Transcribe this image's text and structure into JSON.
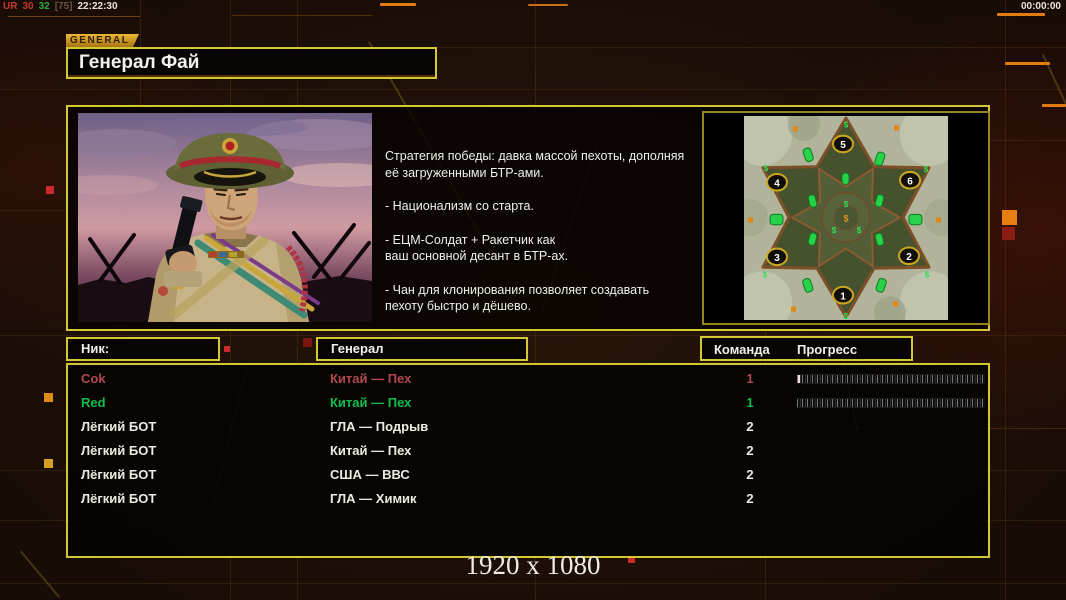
{
  "hud": {
    "stats_parts": [
      {
        "text": "UR",
        "color": "#c23b2b"
      },
      {
        "text": "30",
        "color": "#c23b2b"
      },
      {
        "text": "32",
        "color": "#2fa644"
      },
      {
        "text": "[75]",
        "color": "#6b5140"
      },
      {
        "text": "22:22:30",
        "color": "#e8e4d8"
      }
    ],
    "match_timer": "00:00:00"
  },
  "header": {
    "tab_label": "GENERAL",
    "title": "Генерал Фай"
  },
  "briefing": {
    "paragraphs": [
      "Стратегия победы: давка массой пехоты, дополняя\n её загруженными БТР-ами.",
      "- Национализм со старта.",
      "- ЕЦМ-Солдат + Ракетчик как\nваш основной десант в БТР-ах.",
      "- Чан для клонирования позволяет создавать\n пехоту быстро и дёшево."
    ]
  },
  "map_preview": {
    "start_positions": [
      "1",
      "2",
      "3",
      "4",
      "5",
      "6"
    ],
    "supply_icon": "$"
  },
  "roster": {
    "headers": {
      "nick": "Ник:",
      "general": "Генерал",
      "team": "Команда",
      "progress": "Прогресс"
    },
    "players": [
      {
        "name": "Cok",
        "general": "Китай — Пех",
        "team": "1",
        "color": "#b0494f"
      },
      {
        "name": "Red",
        "general": "Китай — Пех",
        "team": "1",
        "color": "#12bd4d"
      },
      {
        "name": "Лёгкий БОТ",
        "general": "ГЛА — Подрыв",
        "team": "2",
        "color": "#eceae2"
      },
      {
        "name": "Лёгкий БОТ",
        "general": "Китай — Пех",
        "team": "2",
        "color": "#eceae2"
      },
      {
        "name": "Лёгкий БОТ",
        "general": "США — ВВС",
        "team": "2",
        "color": "#eceae2"
      },
      {
        "name": "Лёгкий БОТ",
        "general": "ГЛА — Химик",
        "team": "2",
        "color": "#eceae2"
      }
    ]
  },
  "footer": {
    "resolution": "1920 x 1080"
  }
}
